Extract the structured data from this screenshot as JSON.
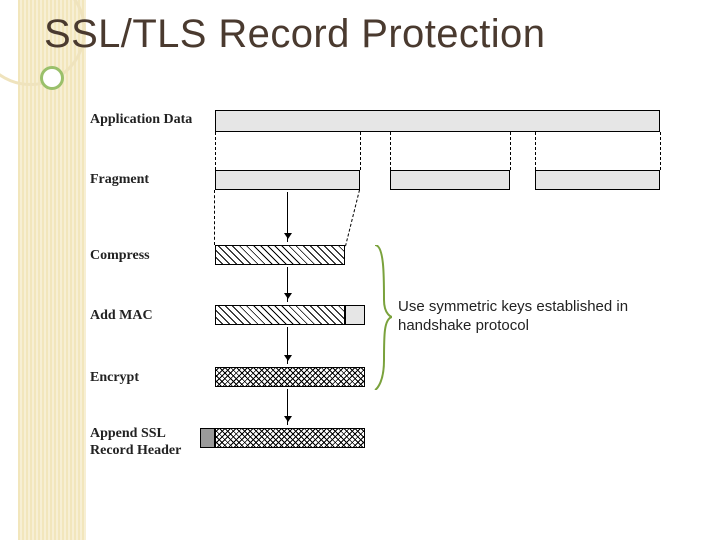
{
  "title": "SSL/TLS Record Protection",
  "steps": {
    "application_data": "Application Data",
    "fragment": "Fragment",
    "compress": "Compress",
    "add_mac": "Add MAC",
    "encrypt": "Encrypt",
    "append_header_line1": "Append SSL",
    "append_header_line2": "Record Header"
  },
  "annotation": "Use symmetric keys established in handshake protocol",
  "palette": {
    "title_color": "#4a3a2f",
    "brace_color": "#7aa23c",
    "band_color": "#f0e3b5"
  }
}
